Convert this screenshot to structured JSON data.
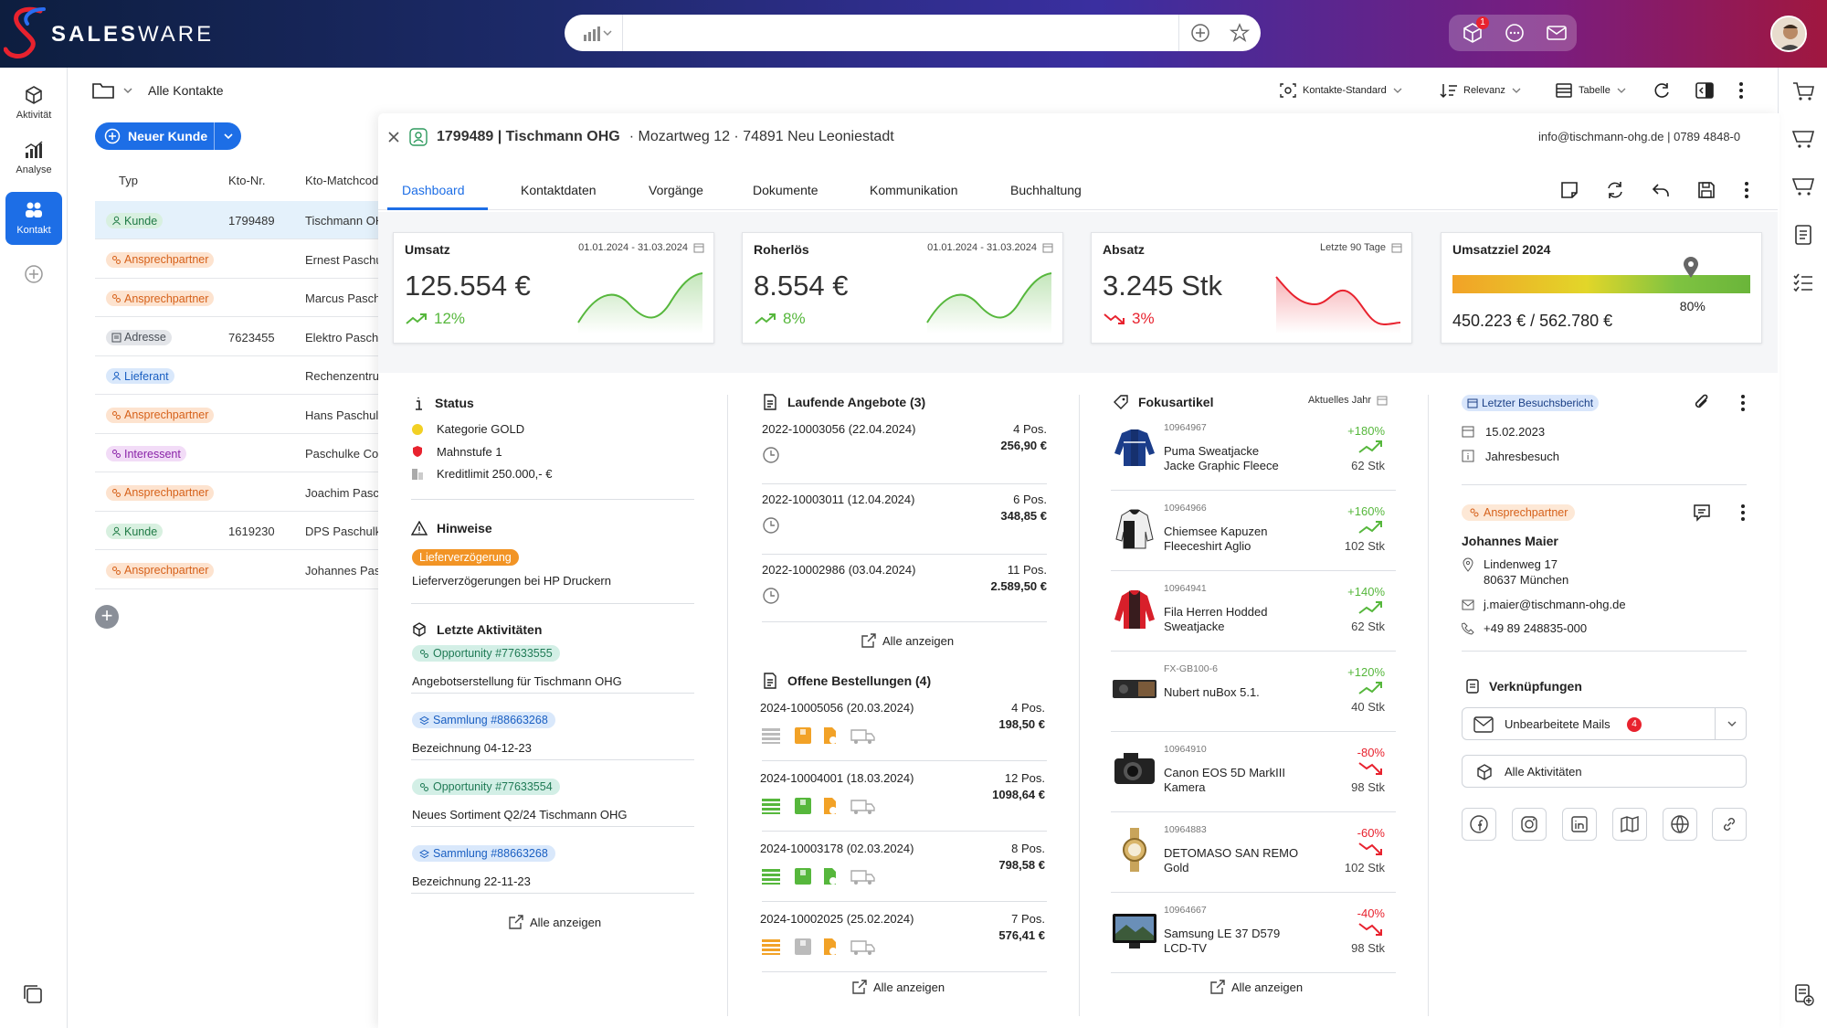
{
  "app": {
    "brand_bold": "SALES",
    "brand_light": "WARE",
    "notif_count": "1"
  },
  "colors": {
    "accent": "#1d6ee6",
    "positive": "#56b73c",
    "negative": "#e8222e",
    "kunde": "#2e9a5e",
    "ansprech": "#e87a22",
    "adresse": "#6b7280",
    "lieferant": "#1d6ee6",
    "interessent": "#a134c9"
  },
  "rail": {
    "items": [
      {
        "label": "Aktivität"
      },
      {
        "label": "Analyse"
      },
      {
        "label": "Kontakt"
      }
    ]
  },
  "list": {
    "breadcrumb": "Alle Kontakte",
    "new_button": "Neuer Kunde",
    "headers": {
      "typ": "Typ",
      "kto": "Kto-Nr.",
      "match": "Kto-Matchcode"
    },
    "rows": [
      {
        "type": "Kunde",
        "kto": "1799489",
        "match": "Tischmann OHG"
      },
      {
        "type": "Ansprechpartner",
        "kto": "",
        "match": "Ernest Paschulke"
      },
      {
        "type": "Ansprechpartner",
        "kto": "",
        "match": "Marcus Paschulke"
      },
      {
        "type": "Adresse",
        "kto": "7623455",
        "match": "Elektro Paschulke"
      },
      {
        "type": "Lieferant",
        "kto": "",
        "match": "Rechenzentrum"
      },
      {
        "type": "Ansprechpartner",
        "kto": "",
        "match": "Hans Paschulke"
      },
      {
        "type": "Interessent",
        "kto": "",
        "match": "Paschulke Co"
      },
      {
        "type": "Ansprechpartner",
        "kto": "",
        "match": "Joachim Paschulke"
      },
      {
        "type": "Kunde",
        "kto": "1619230",
        "match": "DPS Paschulke"
      },
      {
        "type": "Ansprechpartner",
        "kto": "",
        "match": "Johannes Paschulke"
      }
    ]
  },
  "toolbar": {
    "view": "Kontakte-Standard",
    "sort": "Relevanz",
    "layout": "Tabelle"
  },
  "detail": {
    "id_name": "1799489 | Tischmann OHG",
    "address": "· Mozartweg 12 · 74891 Neu Leoniestadt",
    "contact": "info@tischmann-ohg.de | 0789 4848-0",
    "tabs": [
      "Dashboard",
      "Kontaktdaten",
      "Vorgänge",
      "Dokumente",
      "Kommunikation",
      "Buchhaltung"
    ]
  },
  "kpis": {
    "umsatz": {
      "title": "Umsatz",
      "range": "01.01.2024 - 31.03.2024",
      "value": "125.554 €",
      "change": "12%"
    },
    "rohertrag": {
      "title": "Roherlös",
      "range": "01.01.2024 - 31.03.2024",
      "value": "8.554 €",
      "change": "8%"
    },
    "absatz": {
      "title": "Absatz",
      "range": "Letzte 90 Tage",
      "value": "3.245 Stk",
      "change": "3%"
    },
    "ziel": {
      "title": "Umsatzziel 2024",
      "value": "450.223 € / 562.780 €",
      "percent": "80%",
      "progress": 0.8
    }
  },
  "status": {
    "title": "Status",
    "category": "Kategorie GOLD",
    "dunning": "Mahnstufe 1",
    "credit": "Kreditlimit 250.000,- €",
    "notes_title": "Hinweise",
    "note_tag": "Lieferverzögerung",
    "note_text": "Lieferverzögerungen bei HP Druckern",
    "activities_title": "Letzte Aktivitäten",
    "activities": [
      {
        "tag": "Opportunity #77633555",
        "text": "Angebotserstellung für Tischmann OHG"
      },
      {
        "tag": "Sammlung #88663268",
        "text": "Bezeichnung 04-12-23"
      },
      {
        "tag": "Opportunity #77633554",
        "text": "Neues Sortiment Q2/24 Tischmann OHG"
      },
      {
        "tag": "Sammlung #88663268",
        "text": "Bezeichnung 22-11-23"
      }
    ],
    "show_all": "Alle anzeigen"
  },
  "offers": {
    "title": "Laufende Angebote (3)",
    "items": [
      {
        "id": "2022-10003056 (22.04.2024)",
        "pos": "4 Pos.",
        "amount": "256,90 €"
      },
      {
        "id": "2022-10003011 (12.04.2024)",
        "pos": "6 Pos.",
        "amount": "348,85 €"
      },
      {
        "id": "2022-10002986 (03.04.2024)",
        "pos": "11 Pos.",
        "amount": "2.589,50 €"
      }
    ],
    "show_all": "Alle anzeigen",
    "orders_title": "Offene Bestellungen (4)",
    "orders": [
      {
        "id": "2024-10005056 (20.03.2024)",
        "pos": "4 Pos.",
        "amount": "198,50 €"
      },
      {
        "id": "2024-10004001 (18.03.2024)",
        "pos": "12 Pos.",
        "amount": "1098,64 €"
      },
      {
        "id": "2024-10003178 (02.03.2024)",
        "pos": "8 Pos.",
        "amount": "798,58 €"
      },
      {
        "id": "2024-10002025 (25.02.2024)",
        "pos": "7 Pos.",
        "amount": "576,41 €"
      }
    ],
    "orders_show_all": "Alle anzeigen"
  },
  "focus": {
    "title": "Fokusartikel",
    "period": "Aktuelles Jahr",
    "items": [
      {
        "id": "10964967",
        "name1": "Puma Sweatjacke",
        "name2": "Jacke Graphic Fleece",
        "pct": "+180%",
        "qty": "62 Stk"
      },
      {
        "id": "10964966",
        "name1": "Chiemsee Kapuzen",
        "name2": "Fleeceshirt Aglio",
        "pct": "+160%",
        "qty": "102 Stk"
      },
      {
        "id": "10964941",
        "name1": "Fila Herren Hodded",
        "name2": "Sweatjacke",
        "pct": "+140%",
        "qty": "62 Stk"
      },
      {
        "id": "FX-GB100-6",
        "name1": "Nubert nuBox 5.1.",
        "name2": "",
        "pct": "+120%",
        "qty": "40 Stk"
      },
      {
        "id": "10964910",
        "name1": "Canon EOS 5D MarkIII",
        "name2": "Kamera",
        "pct": "-80%",
        "qty": "98 Stk"
      },
      {
        "id": "10964883",
        "name1": "DETOMASO SAN REMO",
        "name2": "Gold",
        "pct": "-60%",
        "qty": "102 Stk"
      },
      {
        "id": "10964667",
        "name1": "Samsung LE 37 D579",
        "name2": "LCD-TV",
        "pct": "-40%",
        "qty": "98 Stk"
      }
    ],
    "show_all": "Alle anzeigen"
  },
  "visit": {
    "tag": "Letzter Besuchsbericht",
    "date": "15.02.2023",
    "type": "Jahresbesuch",
    "contact_tag": "Ansprechpartner",
    "name": "Johannes Maier",
    "street": "Lindenweg 17",
    "city": "80637 München",
    "email": "j.maier@tischmann-ohg.de",
    "phone": "+49 89 248835-000",
    "links_title": "Verknüpfungen",
    "mails": "Unbearbeitete Mails",
    "mails_count": "4",
    "activities": "Alle Aktivitäten"
  }
}
